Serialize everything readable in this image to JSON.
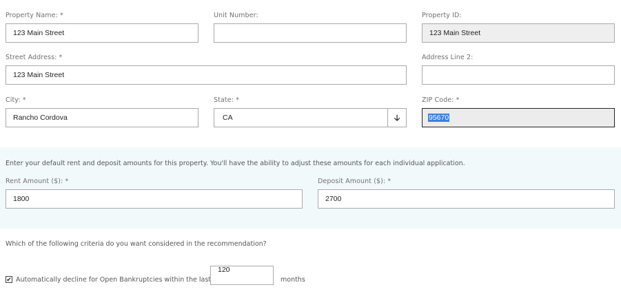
{
  "form": {
    "property_name": {
      "label": "Property Name: *",
      "value": "123 Main Street"
    },
    "unit_number": {
      "label": "Unit Number:",
      "value": ""
    },
    "property_id": {
      "label": "Property ID:",
      "value": "123 Main Street"
    },
    "street_address": {
      "label": "Street Address: *",
      "value": "123 Main Street"
    },
    "address_line2": {
      "label": "Address Line 2:",
      "value": ""
    },
    "city": {
      "label": "City: *",
      "value": "Rancho Cordova"
    },
    "state": {
      "label": "State: *",
      "value": "CA",
      "arrow": "🡣"
    },
    "zip": {
      "label": "ZIP Code: *",
      "value": "95670"
    }
  },
  "amounts": {
    "intro": "Enter your default rent and deposit amounts for this property. You'll have the ability to adjust these amounts for each individual application.",
    "rent": {
      "label": "Rent Amount ($): *",
      "value": "1800"
    },
    "deposit": {
      "label": "Deposit Amount ($): *",
      "value": "2700"
    }
  },
  "criteria": {
    "question": "Which of the following criteria do you want considered in the recommendation?",
    "bankruptcy": {
      "checked": true,
      "check_glyph": "✔",
      "label": "Automatically decline for Open Bankruptcies within the last.",
      "months_value": "120",
      "unit": "months"
    }
  },
  "colors": {
    "band": "#f2f9fb",
    "selection": "#3d7fe0"
  }
}
